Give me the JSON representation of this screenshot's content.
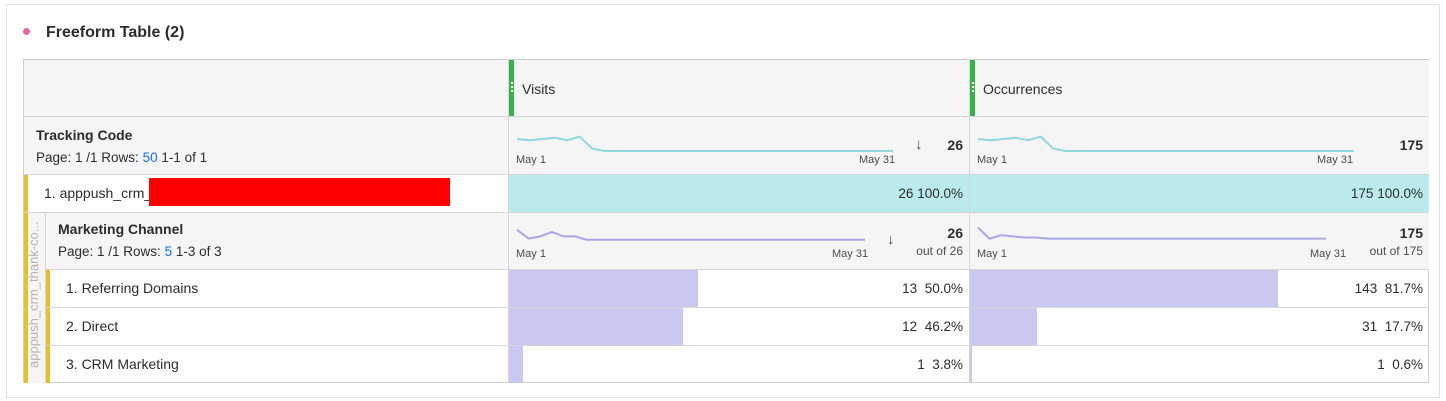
{
  "panel": {
    "title": "Freeform Table (2)"
  },
  "columns": [
    {
      "label": "Visits",
      "grip": "drag-handle"
    },
    {
      "label": "Occurrences",
      "grip": "drag-handle"
    }
  ],
  "colors": {
    "grip": "#37b34a",
    "accent_bar": "#e6c12a",
    "sparkline_top": "#8fd8dd",
    "sparkline_sub": "#a9a7e8",
    "bar_top": "#bbeaed",
    "bar_sub": "#c8c8f0",
    "redaction": "#ff0000",
    "link": "#1473e6"
  },
  "top_dimension": {
    "title": "Tracking Code",
    "page_prefix": "Page: 1 /1 Rows:",
    "rows_value": "50",
    "range": "1-1 of 1",
    "totals": {
      "visits": {
        "value": "26",
        "start": "May 1",
        "end": "May 31",
        "sort_icon": "arrow-down-icon"
      },
      "occurrences": {
        "value": "175",
        "start": "May 1",
        "end": "May 31"
      }
    },
    "row": {
      "label": "1. apppush_crm_",
      "visits": {
        "value": "26",
        "pct": "100.0%",
        "fraction": 1.0
      },
      "occurrences": {
        "value": "175",
        "pct": "100.0%",
        "fraction": 1.0
      }
    }
  },
  "breakdown": {
    "side_label": "apppush_crm_thank-co...",
    "title": "Marketing Channel",
    "page_prefix": "Page: 1 /1 Rows:",
    "rows_value": "5",
    "range": "1-3 of 3",
    "totals": {
      "visits": {
        "value": "26",
        "out_of": "out of 26",
        "start": "May 1",
        "end": "May 31",
        "sort_icon": "arrow-down-icon"
      },
      "occurrences": {
        "value": "175",
        "out_of": "out of 175",
        "start": "May 1",
        "end": "May 31"
      }
    },
    "rows": [
      {
        "label": "1. Referring Domains",
        "visits": {
          "value": "13",
          "pct": "50.0%",
          "fraction": 0.5
        },
        "occurrences": {
          "value": "143",
          "pct": "81.7%",
          "fraction": 0.817
        }
      },
      {
        "label": "2. Direct",
        "visits": {
          "value": "12",
          "pct": "46.2%",
          "fraction": 0.462
        },
        "occurrences": {
          "value": "31",
          "pct": "17.7%",
          "fraction": 0.177
        }
      },
      {
        "label": "3. CRM Marketing",
        "visits": {
          "value": "1",
          "pct": "3.8%",
          "fraction": 0.038
        },
        "occurrences": {
          "value": "1",
          "pct": "0.6%",
          "fraction": 0.006
        }
      }
    ]
  },
  "sparklines": {
    "top_visits": [
      0.5,
      0.45,
      0.5,
      0.55,
      0.45,
      0.6,
      0.1,
      0,
      0,
      0,
      0,
      0,
      0,
      0,
      0,
      0,
      0,
      0,
      0,
      0,
      0,
      0,
      0,
      0,
      0,
      0,
      0,
      0,
      0,
      0,
      0
    ],
    "top_occurrences": [
      0.5,
      0.45,
      0.5,
      0.55,
      0.45,
      0.6,
      0.1,
      0,
      0,
      0,
      0,
      0,
      0,
      0,
      0,
      0,
      0,
      0,
      0,
      0,
      0,
      0,
      0,
      0,
      0,
      0,
      0,
      0,
      0,
      0,
      0
    ],
    "sub_visits": [
      0.6,
      0.2,
      0.3,
      0.5,
      0.3,
      0.3,
      0.15,
      0.15,
      0.15,
      0.15,
      0.15,
      0.15,
      0.15,
      0.15,
      0.15,
      0.15,
      0.15,
      0.15,
      0.15,
      0.15,
      0.15,
      0.15,
      0.15,
      0.15,
      0.15,
      0.15,
      0.15,
      0.15,
      0.15,
      0.15,
      0.15
    ],
    "sub_occurrences": [
      0.7,
      0.2,
      0.35,
      0.3,
      0.25,
      0.25,
      0.2,
      0.2,
      0.2,
      0.2,
      0.2,
      0.2,
      0.2,
      0.2,
      0.2,
      0.2,
      0.2,
      0.2,
      0.2,
      0.2,
      0.2,
      0.2,
      0.2,
      0.2,
      0.2,
      0.2,
      0.2,
      0.2,
      0.2,
      0.2,
      0.2
    ]
  }
}
